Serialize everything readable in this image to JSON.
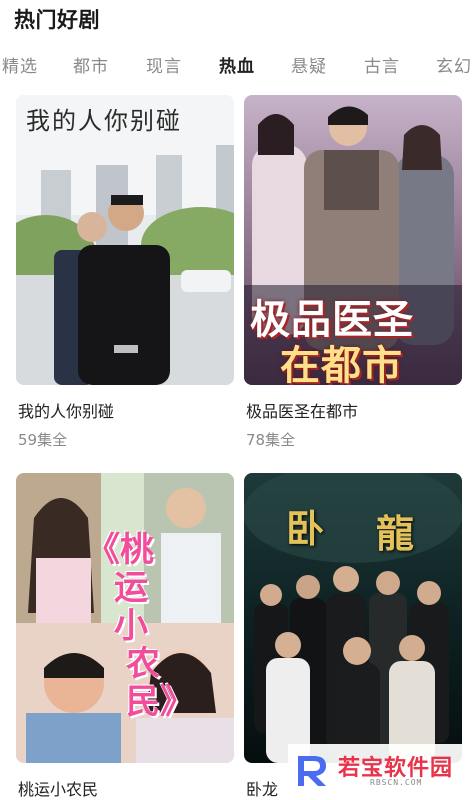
{
  "section": {
    "title": "热门好剧"
  },
  "tabs": [
    {
      "label": "精选",
      "active": false
    },
    {
      "label": "都市",
      "active": false
    },
    {
      "label": "现言",
      "active": false
    },
    {
      "label": "热血",
      "active": true
    },
    {
      "label": "悬疑",
      "active": false
    },
    {
      "label": "古言",
      "active": false
    },
    {
      "label": "玄幻",
      "active": false
    }
  ],
  "dramas": [
    {
      "title": "我的人你别碰",
      "episodes": "59集全",
      "poster_text": "我的人你别碰"
    },
    {
      "title": "极品医圣在都市",
      "episodes": "78集全",
      "poster_text_line1": "极品医圣",
      "poster_text_line2": "在都市"
    },
    {
      "title": "桃运小农民",
      "poster_text": [
        "《",
        "桃",
        "运",
        "小",
        "农",
        "民",
        "》"
      ]
    },
    {
      "title": "卧龙",
      "poster_text": [
        "卧",
        "龍"
      ]
    }
  ],
  "watermark": {
    "text": "若宝软件园",
    "sub": "RBSCN.COM"
  }
}
